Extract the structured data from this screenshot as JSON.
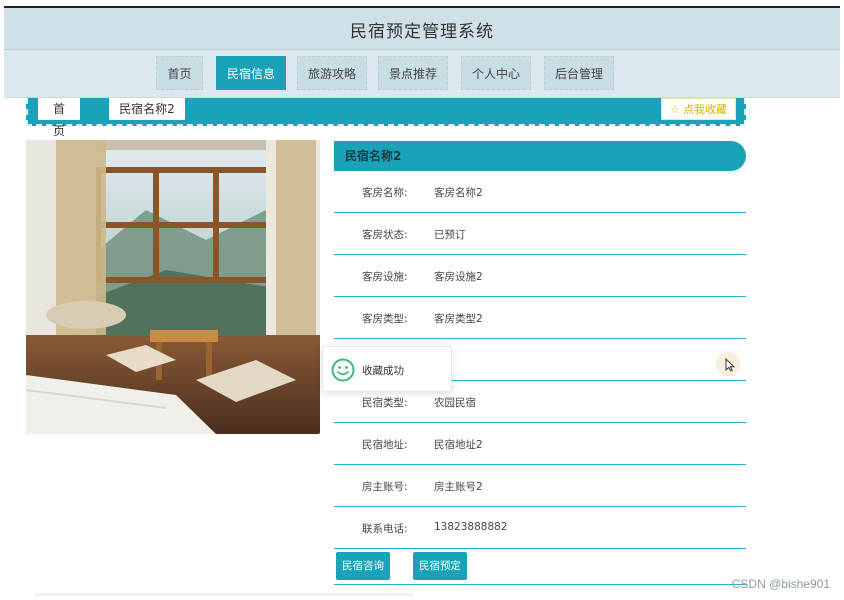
{
  "app": {
    "title": "民宿预定管理系统"
  },
  "nav": {
    "items": [
      {
        "label": "首页",
        "active": false
      },
      {
        "label": "民宿信息",
        "active": true
      },
      {
        "label": "旅游攻略",
        "active": false
      },
      {
        "label": "景点推荐",
        "active": false
      },
      {
        "label": "个人中心",
        "active": false
      },
      {
        "label": "后台管理",
        "active": false
      }
    ]
  },
  "breadcrumb": {
    "home": "首页",
    "current": "民宿名称2"
  },
  "favorite": {
    "label": "点我收藏",
    "icon": "star-icon"
  },
  "detail": {
    "name": "民宿名称2",
    "fields": [
      {
        "label": "客房名称:",
        "value": "客房名称2"
      },
      {
        "label": "客房状态:",
        "value": "已预订"
      },
      {
        "label": "客房设施:",
        "value": "客房设施2"
      },
      {
        "label": "客房类型:",
        "value": "客房类型2"
      },
      {
        "label": "",
        "value": ""
      },
      {
        "label": "民宿类型:",
        "value": "农园民宿"
      },
      {
        "label": "民宿地址:",
        "value": "民宿地址2"
      },
      {
        "label": "房主账号:",
        "value": "房主账号2"
      },
      {
        "label": "联系电话:",
        "value": "13823888882"
      }
    ]
  },
  "actions": {
    "consult": "民宿咨询",
    "book": "民宿预定"
  },
  "toast": {
    "message": "收藏成功",
    "icon": "smile-icon"
  },
  "watermark": "CSDN @bishe901",
  "colors": {
    "accent": "#1aa3b8",
    "header_bg": "#cfe0e8",
    "nav_bg": "#dbe8ee",
    "favorite": "#e0b000"
  }
}
